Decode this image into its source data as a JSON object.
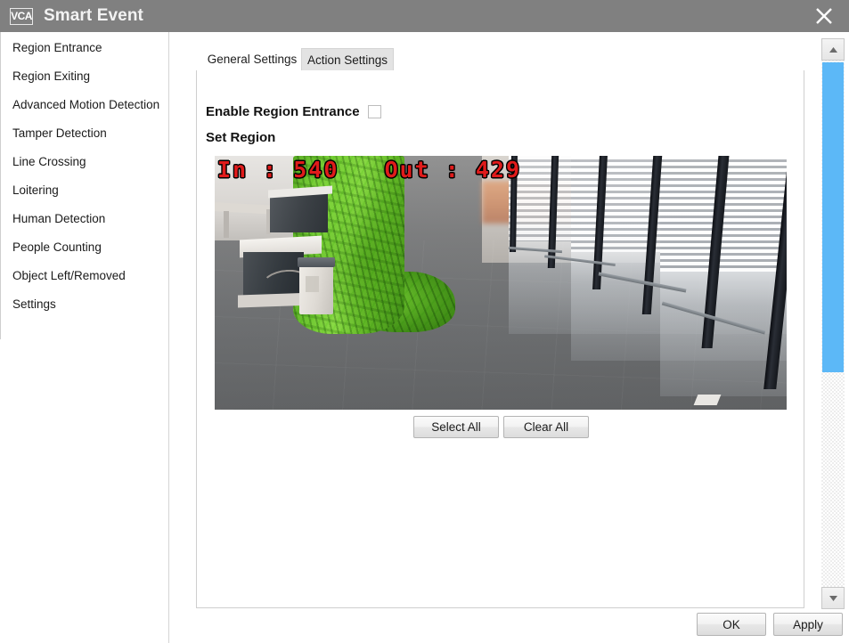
{
  "window": {
    "title": "Smart Event",
    "icon_label": "VCA",
    "icon_name": "vca-icon",
    "close_icon": "close-icon"
  },
  "sidebar": {
    "items": [
      {
        "label": "Region Entrance"
      },
      {
        "label": "Region Exiting"
      },
      {
        "label": "Advanced Motion Detection"
      },
      {
        "label": "Tamper Detection"
      },
      {
        "label": "Line Crossing"
      },
      {
        "label": "Loitering"
      },
      {
        "label": "Human Detection"
      },
      {
        "label": "People Counting"
      },
      {
        "label": "Object Left/Removed"
      },
      {
        "label": "Settings"
      }
    ]
  },
  "tabs": [
    {
      "label": "General Settings",
      "active": true
    },
    {
      "label": "Action Settings",
      "active": false
    }
  ],
  "main": {
    "enable_label": "Enable Region Entrance",
    "enable_checked": false,
    "set_region_label": "Set Region",
    "video": {
      "overlay_text": "In : 540   Out : 429",
      "in_count": 540,
      "out_count": 429,
      "overlay_color": "#e01b1b"
    },
    "select_all_label": "Select All",
    "clear_all_label": "Clear All"
  },
  "footer": {
    "ok_label": "OK",
    "apply_label": "Apply"
  },
  "scrollbar": {
    "up_icon": "scroll-up-arrow-icon",
    "down_icon": "scroll-down-arrow-icon",
    "thumb_color": "#5cb8f7"
  },
  "colors": {
    "titlebar": "#808080",
    "title_text": "#f2f2f2",
    "tab_inactive": "#e3e3e3",
    "accent": "#5cb8f7"
  }
}
